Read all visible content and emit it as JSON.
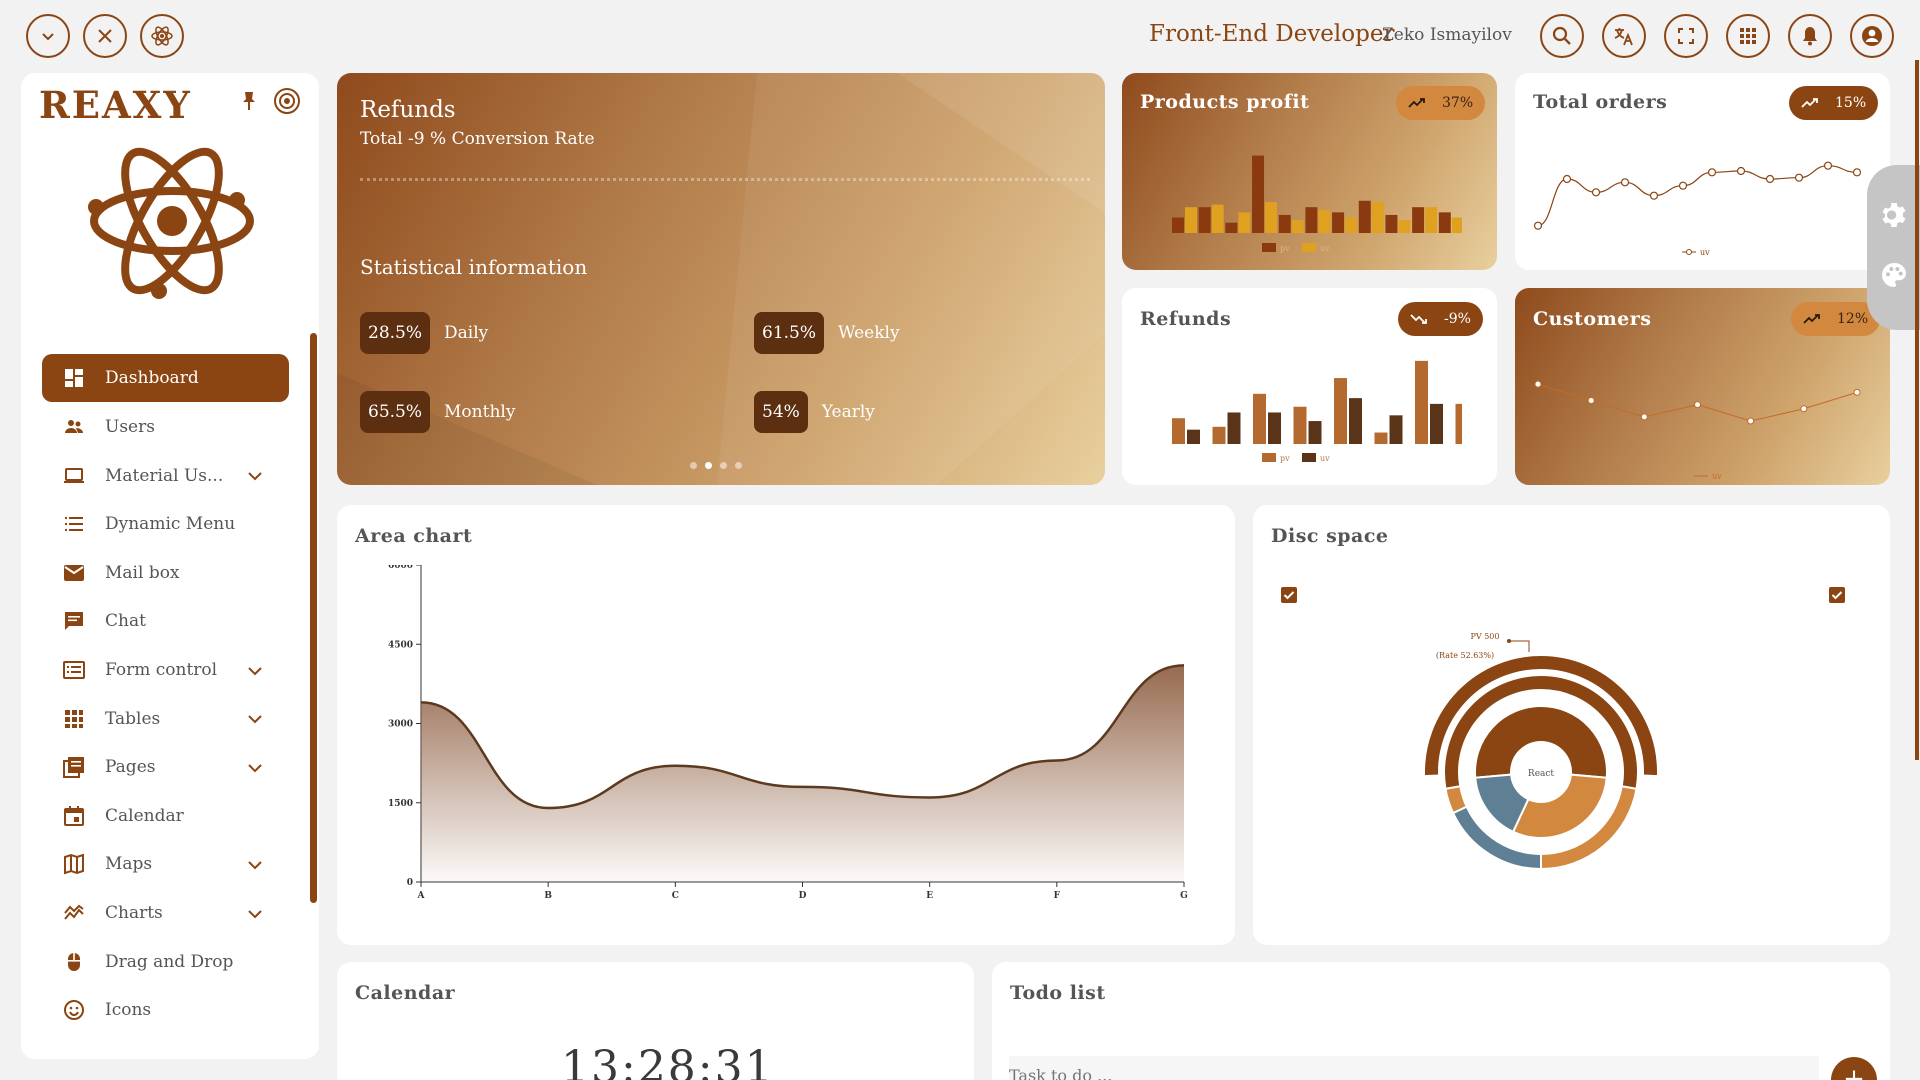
{
  "header": {
    "title": "Front-End Developer",
    "user_name": "Zeko Ismayilov",
    "left_buttons": [
      "chevron-down-icon",
      "close-icon",
      "atom-icon"
    ],
    "right_buttons": [
      "search-icon",
      "translate-icon",
      "fullscreen-icon",
      "apps-icon",
      "bell-icon",
      "account-icon"
    ]
  },
  "sidebar": {
    "logo": "REAXY",
    "items": [
      {
        "label": "Dashboard",
        "icon": "dashboard-icon",
        "active": true,
        "expandable": false
      },
      {
        "label": "Users",
        "icon": "users-icon",
        "expandable": false
      },
      {
        "label": "Material Us...",
        "icon": "laptop-icon",
        "expandable": true
      },
      {
        "label": "Dynamic Menu",
        "icon": "list-icon",
        "expandable": false
      },
      {
        "label": "Mail box",
        "icon": "mail-icon",
        "expandable": false
      },
      {
        "label": "Chat",
        "icon": "chat-icon",
        "expandable": false
      },
      {
        "label": "Form control",
        "icon": "form-icon",
        "expandable": true
      },
      {
        "label": "Tables",
        "icon": "grid-icon",
        "expandable": true
      },
      {
        "label": "Pages",
        "icon": "pages-icon",
        "expandable": true
      },
      {
        "label": "Calendar",
        "icon": "calendar-icon",
        "expandable": false
      },
      {
        "label": "Maps",
        "icon": "map-icon",
        "expandable": true
      },
      {
        "label": "Charts",
        "icon": "chart-icon",
        "expandable": true
      },
      {
        "label": "Drag and Drop",
        "icon": "mouse-icon",
        "expandable": false
      },
      {
        "label": "Icons",
        "icon": "smile-icon",
        "expandable": false
      }
    ]
  },
  "refunds_banner": {
    "title": "Refunds",
    "subtitle": "Total -9 % Conversion Rate",
    "stat_title": "Statistical information",
    "stats": [
      {
        "value": "28.5%",
        "label": "Daily"
      },
      {
        "value": "61.5%",
        "label": "Weekly"
      },
      {
        "value": "65.5%",
        "label": "Monthly"
      },
      {
        "value": "54%",
        "label": "Yearly"
      }
    ],
    "carousel_active": 1,
    "carousel_count": 4
  },
  "products_profit": {
    "title": "Products profit",
    "badge": "37%",
    "trend": "up",
    "legend": [
      "pv",
      "uv"
    ],
    "pv": [
      12,
      20,
      8,
      60,
      14,
      20,
      16,
      25,
      14,
      20,
      16,
      22,
      18
    ],
    "uv": [
      20,
      22,
      16,
      24,
      10,
      18,
      12,
      24,
      10,
      20,
      12,
      16,
      20
    ]
  },
  "total_orders": {
    "title": "Total orders",
    "badge": "15%",
    "trend": "up",
    "legend": [
      "uv"
    ],
    "uv": [
      2,
      9,
      7,
      8.5,
      6.5,
      8,
      10,
      10.2,
      9,
      9.2,
      11,
      10
    ]
  },
  "refunds_small": {
    "title": "Refunds",
    "badge": "-9%",
    "trend": "down",
    "legend": [
      "pv",
      "uv"
    ],
    "pv": [
      18,
      12,
      35,
      26,
      46,
      8,
      58,
      28,
      14
    ],
    "uv": [
      10,
      22,
      22,
      16,
      32,
      20,
      28,
      18,
      10
    ]
  },
  "customers": {
    "title": "Customers",
    "badge": "12%",
    "trend": "up",
    "legend": [
      "uv"
    ],
    "uv": [
      10,
      8,
      6,
      7.5,
      5.5,
      7,
      9
    ]
  },
  "area_chart": {
    "title": "Area chart",
    "chart_data": {
      "type": "area",
      "categories": [
        "A",
        "B",
        "C",
        "D",
        "E",
        "F",
        "G"
      ],
      "values": [
        3400,
        1400,
        2200,
        1800,
        1600,
        2300,
        4100
      ],
      "ylim": [
        0,
        6000
      ],
      "yticks": [
        "0",
        "1500",
        "3000",
        "4500",
        "6000"
      ],
      "color": "#5c3a20"
    }
  },
  "disc_space": {
    "title": "Disc space",
    "tooltip_line1": "PV 500",
    "tooltip_line2": "(Rate 52.63%)",
    "center_label": "React",
    "chart_data": {
      "type": "pie",
      "rings": [
        {
          "name": "outer",
          "values": [
            50
          ]
        },
        {
          "name": "middle",
          "values": [
            26,
            24
          ]
        },
        {
          "name": "inner",
          "values": [
            50,
            50
          ]
        }
      ],
      "colors": [
        "#8b4513",
        "#d2883f",
        "#5f7f95"
      ]
    }
  },
  "calendar": {
    "title": "Calendar",
    "time": "13:28:31"
  },
  "todo": {
    "title": "Todo list",
    "placeholder": "Task to do ...",
    "add_label": "+"
  }
}
